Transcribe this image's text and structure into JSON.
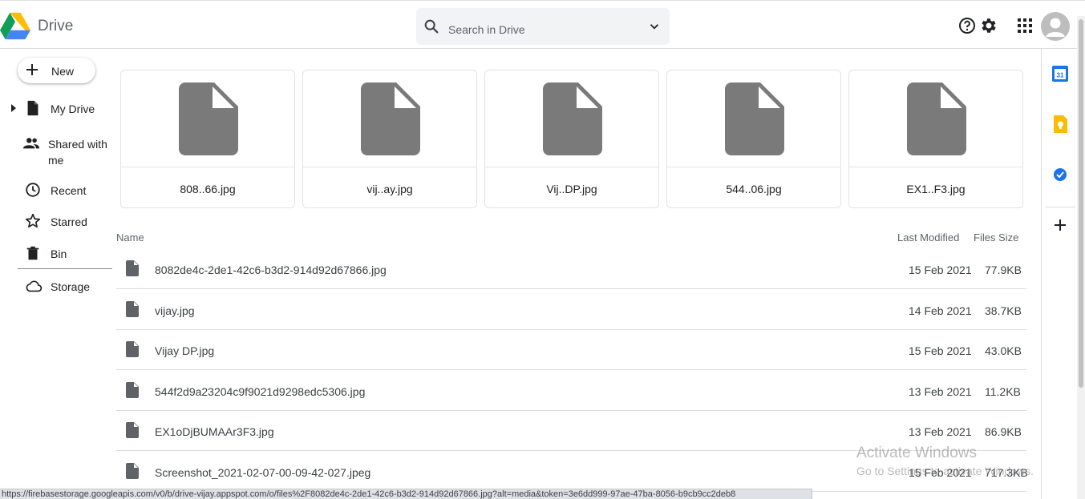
{
  "header": {
    "brand": "Drive",
    "search_placeholder": "Search in Drive"
  },
  "sidebar": {
    "new_label": "New",
    "items": [
      {
        "label": "My Drive"
      },
      {
        "label": "Shared with me"
      },
      {
        "label": "Recent"
      },
      {
        "label": "Starred"
      },
      {
        "label": "Bin"
      },
      {
        "label": "Storage"
      }
    ]
  },
  "grid": {
    "cards": [
      {
        "name": "808..66.jpg"
      },
      {
        "name": "vij..ay.jpg"
      },
      {
        "name": "Vij..DP.jpg"
      },
      {
        "name": "544..06.jpg"
      },
      {
        "name": "EX1..F3.jpg"
      }
    ]
  },
  "list": {
    "col_name": "Name",
    "col_modified": "Last Modified",
    "col_size": "Files Size",
    "rows": [
      {
        "name": "8082de4c-2de1-42c6-b3d2-914d92d67866.jpg",
        "date": "15 Feb 2021",
        "size": "77.9KB"
      },
      {
        "name": "vijay.jpg",
        "date": "14 Feb 2021",
        "size": "38.7KB"
      },
      {
        "name": "Vijay DP.jpg",
        "date": "15 Feb 2021",
        "size": "43.0KB"
      },
      {
        "name": "544f2d9a23204c9f9021d9298edc5306.jpg",
        "date": "13 Feb 2021",
        "size": "11.2KB"
      },
      {
        "name": "EX1oDjBUMAAr3F3.jpg",
        "date": "13 Feb 2021",
        "size": "86.9KB"
      },
      {
        "name": "Screenshot_2021-02-07-00-09-42-027.jpeg",
        "date": "15 Feb 2021",
        "size": "717.3KB"
      }
    ]
  },
  "right_panel": {
    "calendar_day": "31"
  },
  "statusbar": {
    "url": "https://firebasestorage.googleapis.com/v0/b/drive-vijay.appspot.com/o/files%2F8082de4c-2de1-42c6-b3d2-914d92d67866.jpg?alt=media&token=3e6dd999-97ae-47ba-8056-b9cb9cc2deb8"
  },
  "watermark": {
    "line1": "Activate Windows",
    "line2": "Go to Settings to activate Windows."
  },
  "colors": {
    "accent_blue": "#1a73e8",
    "keep_yellow": "#fbbc04",
    "file_icon_gray": "#7a7a7a",
    "text_dark": "#202124"
  },
  "icons": [
    "drive-logo-icon",
    "search-icon",
    "chevron-down-icon",
    "help-icon",
    "gear-icon",
    "apps-grid-icon",
    "account-icon",
    "plus-icon",
    "my-drive-icon",
    "shared-icon",
    "clock-icon",
    "star-icon",
    "trash-icon",
    "cloud-icon",
    "file-icon",
    "calendar-icon",
    "keep-icon",
    "tasks-icon"
  ]
}
